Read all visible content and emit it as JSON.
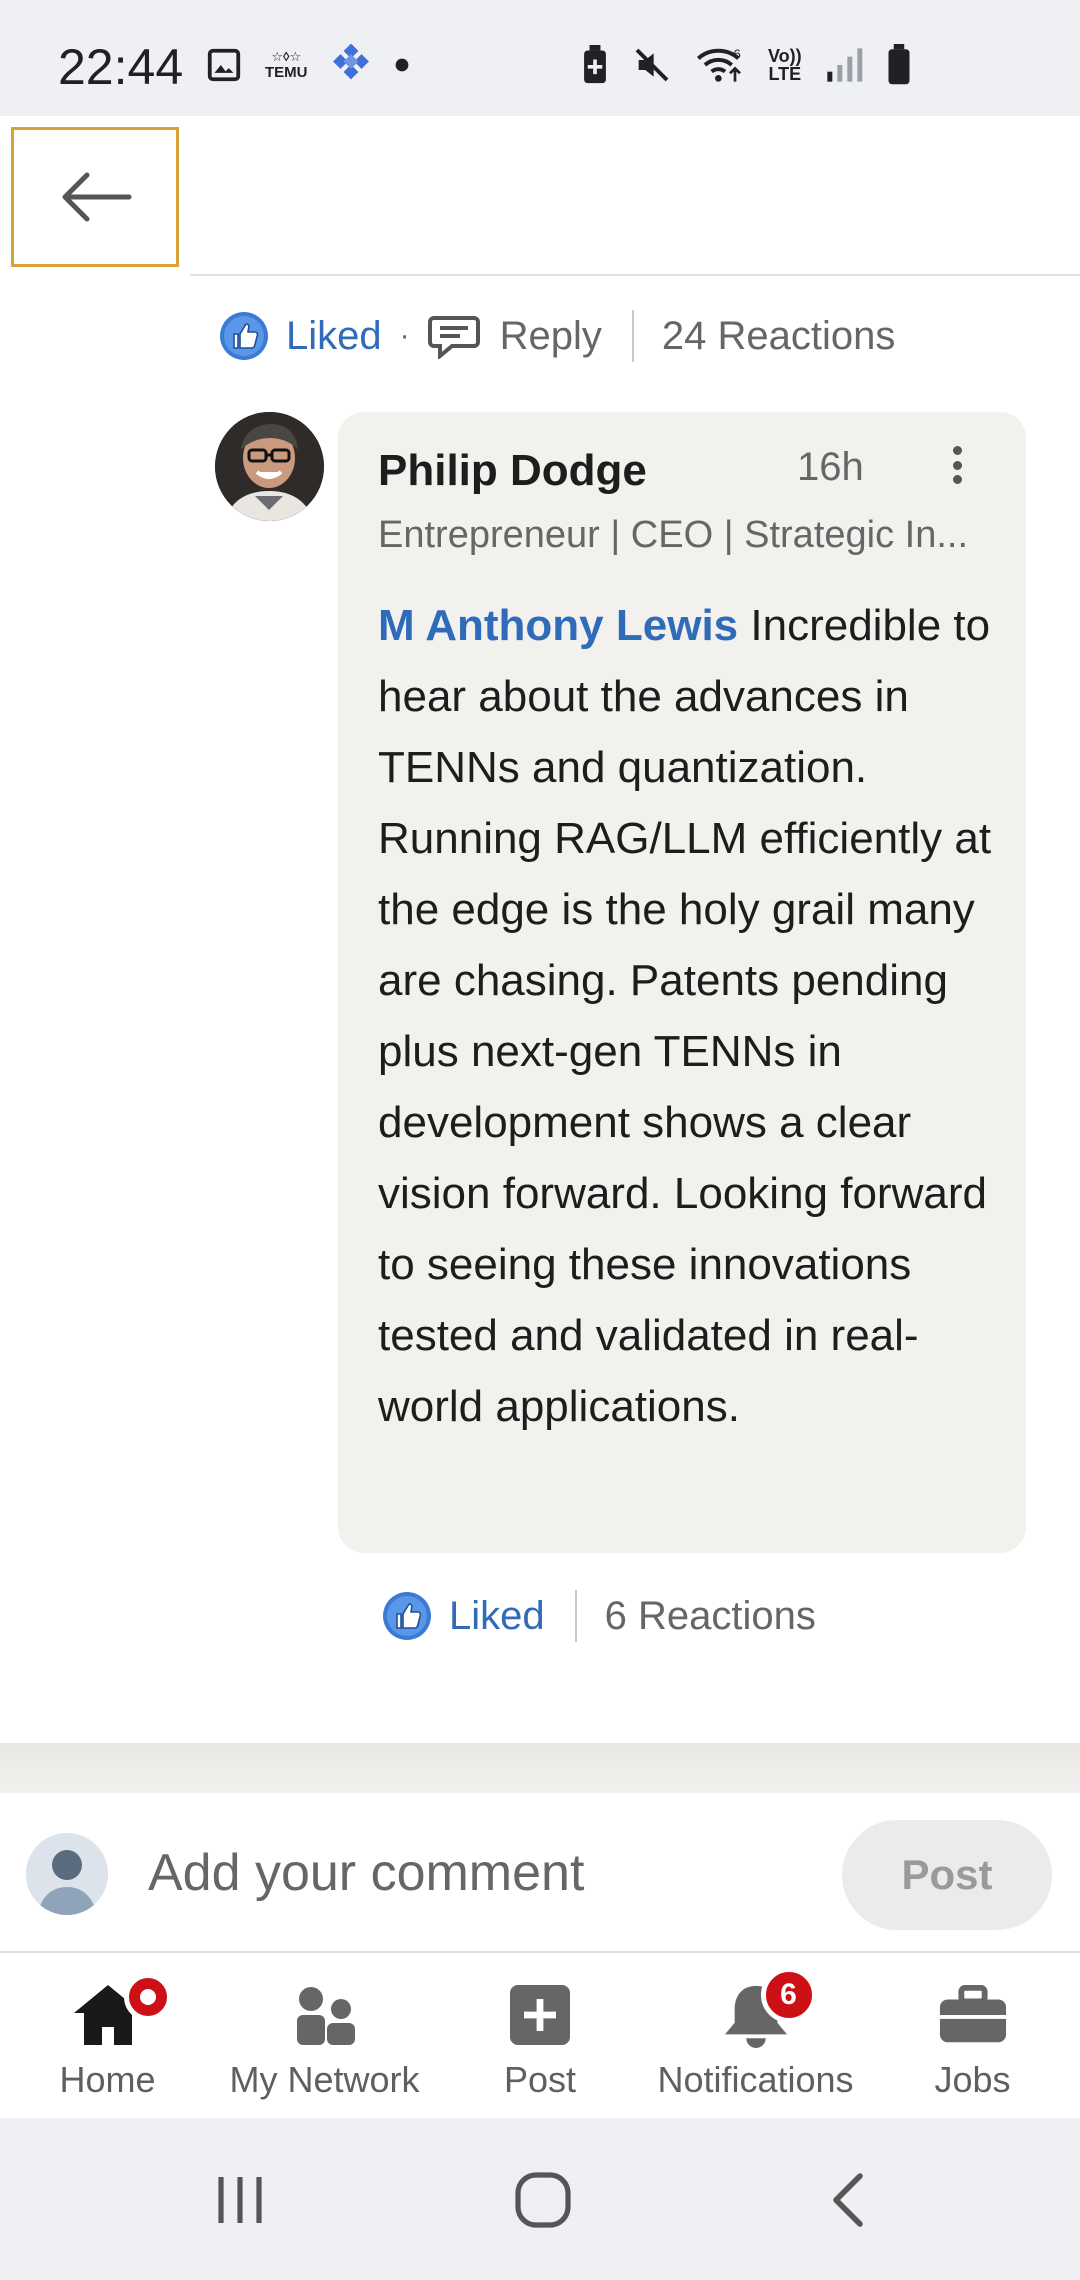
{
  "status_bar": {
    "time": "22:44",
    "left_icons": [
      "image-icon",
      "temu-icon",
      "app-grid-icon",
      "dot-icon"
    ],
    "temu_label": "TEMU",
    "right_icons": [
      "battery-saver-icon",
      "mute-icon",
      "wifi-icon",
      "volte-icon",
      "signal-icon",
      "battery-icon"
    ],
    "volte_label_top": "Vo))",
    "volte_label_bottom": "LTE"
  },
  "topbar": {
    "back_icon": "arrow-left-icon"
  },
  "parent_comment_actions": {
    "liked_label": "Liked",
    "separator": "·",
    "reply_label": "Reply",
    "reactions_label": "24 Reactions"
  },
  "comment": {
    "author": "Philip Dodge",
    "time": "16h",
    "headline": "Entrepreneur | CEO | Strategic In...",
    "mention": "M Anthony Lewis",
    "body": "Incredible to hear about the advances in TENNs and quantization. Running RAG/LLM efficiently at the edge is the holy grail many are chasing. Patents pending plus next-gen TENNs in development shows a clear vision forward. Looking forward to seeing these innovations tested and validated in real-world applications.",
    "liked_label": "Liked",
    "reactions_label": "6 Reactions"
  },
  "composer": {
    "placeholder": "Add your comment",
    "post_label": "Post"
  },
  "bottom_nav": {
    "items": [
      {
        "label": "Home",
        "icon": "home-icon",
        "badge": ""
      },
      {
        "label": "My Network",
        "icon": "network-icon"
      },
      {
        "label": "Post",
        "icon": "post-icon"
      },
      {
        "label": "Notifications",
        "icon": "bell-icon",
        "badge": "6"
      },
      {
        "label": "Jobs",
        "icon": "briefcase-icon"
      }
    ]
  },
  "colors": {
    "link_blue": "#2f6bb9",
    "badge_red": "#cc1016",
    "bubble_bg": "#f2f1ee",
    "focus_outline": "#d8a13a"
  }
}
